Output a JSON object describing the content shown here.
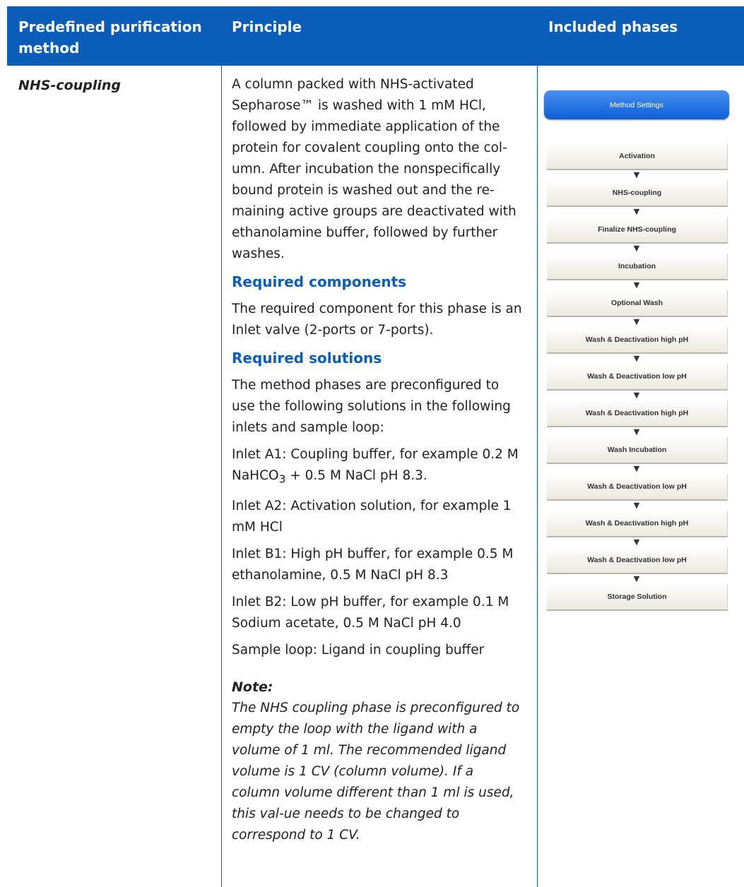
{
  "table": {
    "headers": [
      "Predefined purification method",
      "Principle",
      "Included phases"
    ],
    "method": "NHS-coupling"
  },
  "principle": {
    "intro": "A column packed with NHS-activated Sepharose™ is washed with 1 mM HCl, followed by immediate application of the protein for covalent coupling onto the col-umn. After incubation the nonspecifically bound protein is washed out and the re-maining active groups are deactivated with ethanolamine buffer, followed by further washes.",
    "components_heading": "Required components",
    "components_text": "The required component for this phase is an Inlet valve (2-ports or 7-ports).",
    "solutions_heading": "Required solutions",
    "solutions_intro": "The method phases are preconfigured to use the following solutions in the following inlets and sample loop:",
    "inlet_a1_pre": "Inlet A1: Coupling buffer, for example 0.2 M NaHCO",
    "inlet_a1_sub": "3",
    "inlet_a1_post": " + 0.5 M NaCl pH 8.3.",
    "inlet_a2": "Inlet A2: Activation solution, for example 1 mM HCl",
    "inlet_b1": "Inlet B1: High pH buffer, for example 0.5 M ethanolamine, 0.5 M NaCl pH 8.3",
    "inlet_b2": "Inlet B2: Low pH buffer, for example 0.1 M Sodium acetate, 0.5 M NaCl pH 4.0",
    "sample_loop": "Sample loop: Ligand in coupling buffer",
    "note_heading": "Note:",
    "note_text": "The NHS coupling phase is preconfigured to empty the loop with the ligand with a volume of 1 ml. The recommended ligand volume is 1 CV (column volume). If a column volume different than 1 ml is used, this val-ue needs to be changed to correspond to 1 CV."
  },
  "phases": {
    "settings_label": "Method Settings",
    "steps": [
      "Activation",
      "NHS-coupling",
      "Finalize NHS-coupling",
      "Incubation",
      "Optional Wash",
      "Wash & Deactivation high pH",
      "Wash & Deactivation low pH",
      "Wash & Deactivation high pH",
      "Wash Incubation",
      "Wash & Deactivation low pH",
      "Wash & Deactivation high pH",
      "Wash & Deactivation low pH",
      "Storage Solution"
    ],
    "arrow_glyph": "▼"
  }
}
